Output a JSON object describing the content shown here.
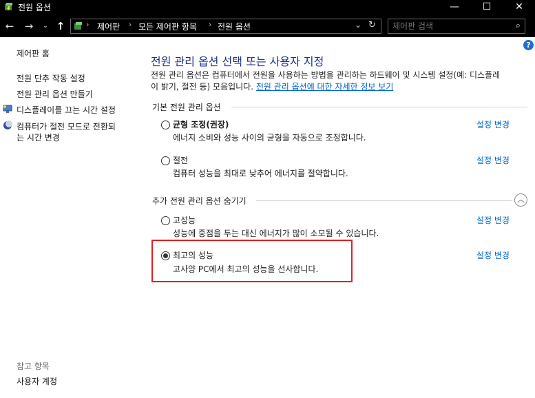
{
  "window": {
    "title": "전원 옵션"
  },
  "address": {
    "crumbs": [
      "제어판",
      "모든 제어판 항목",
      "전원 옵션"
    ]
  },
  "search": {
    "placeholder": "제어판 검색"
  },
  "sidebar": {
    "home": "제어판 홈",
    "links": [
      "전원 단추 작동 설정",
      "전원 관리 옵션 만들기",
      "디스플레이를 끄는 시간 설정",
      "컴퓨터가 절전 모드로 전환되",
      "는 시간 변경"
    ],
    "see_also": "참고 항목",
    "user_accounts": "사용자 계정"
  },
  "main": {
    "title": "전원 관리 옵션 선택 또는 사용자 지정",
    "desc_line1": "전원 관리 옵션은 컴퓨터에서 전원을 사용하는 방법을 관리하는 하드웨어 및 시스템 설정(예: 디스플레",
    "desc_line2": "이 밝기, 절전 등) 모음입니다. ",
    "desc_link": "전원 관리 옵션에 대한 자세한 정보 보기",
    "basic_section": "기본 전원 관리 옵션",
    "hidden_section": "추가 전원 관리 옵션 숨기기",
    "change_label": "설정 변경",
    "plans": [
      {
        "name": "균형 조정(권장)",
        "desc": "에너지 소비와 성능 사이의 균형을 자동으로 조정합니다.",
        "selected": false
      },
      {
        "name": "절전",
        "desc": "컴퓨터 성능을 최대로 낮추어 에너지를 절약합니다.",
        "selected": false
      },
      {
        "name": "고성능",
        "desc": "성능에 중점을 두는 대신 에너지가 많이 소모될 수 있습니다.",
        "selected": false
      },
      {
        "name": "최고의 성능",
        "desc": "고사양 PC에서 최고의 성능을 선사합니다.",
        "selected": true
      }
    ]
  },
  "colors": {
    "link": "#0066cc",
    "title": "#1e3287",
    "highlight": "#e02020",
    "titlebar": "#000000"
  }
}
